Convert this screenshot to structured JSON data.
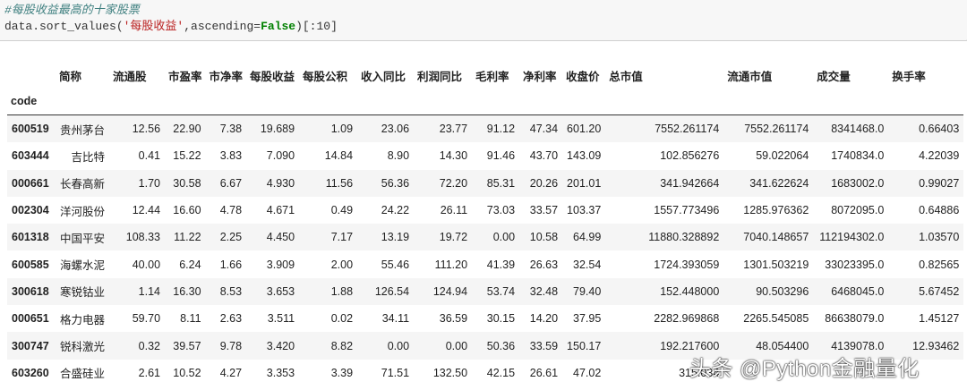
{
  "code_cell": {
    "comment": "#每股收益最高的十家股票",
    "code_prefix": "data.sort_values(",
    "code_string": "'每股收益'",
    "code_mid": ",ascending=",
    "code_keyword": "False",
    "code_suffix": ")[:10]"
  },
  "table": {
    "index_name": "code",
    "columns": [
      "简称",
      "流通股",
      "市盈率",
      "市净率",
      "每股收益",
      "每股公积",
      "收入同比",
      "利润同比",
      "毛利率",
      "净利率",
      "收盘价",
      "总市值",
      "流通市值",
      "成交量",
      "换手率"
    ],
    "rows": [
      [
        "600519",
        "贵州茅台",
        "12.56",
        "22.90",
        "7.38",
        "19.689",
        "1.09",
        "23.06",
        "23.77",
        "91.12",
        "47.34",
        "601.20",
        "7552.261174",
        "7552.261174",
        "8341468.0",
        "0.66403"
      ],
      [
        "603444",
        "吉比特",
        "0.41",
        "15.22",
        "3.83",
        "7.090",
        "14.84",
        "8.90",
        "14.30",
        "91.46",
        "43.70",
        "143.09",
        "102.856276",
        "59.022064",
        "1740834.0",
        "4.22039"
      ],
      [
        "000661",
        "长春高新",
        "1.70",
        "30.58",
        "6.67",
        "4.930",
        "11.56",
        "56.36",
        "72.20",
        "85.31",
        "20.26",
        "201.01",
        "341.942664",
        "341.622624",
        "1683002.0",
        "0.99027"
      ],
      [
        "002304",
        "洋河股份",
        "12.44",
        "16.60",
        "4.78",
        "4.671",
        "0.49",
        "24.22",
        "26.11",
        "73.03",
        "33.57",
        "103.37",
        "1557.773496",
        "1285.976362",
        "8072095.0",
        "0.64886"
      ],
      [
        "601318",
        "中国平安",
        "108.33",
        "11.22",
        "2.25",
        "4.450",
        "7.17",
        "13.19",
        "19.72",
        "0.00",
        "10.58",
        "64.99",
        "11880.328892",
        "7040.148657",
        "112194302.0",
        "1.03570"
      ],
      [
        "600585",
        "海螺水泥",
        "40.00",
        "6.24",
        "1.66",
        "3.909",
        "2.00",
        "55.46",
        "111.20",
        "41.39",
        "26.63",
        "32.54",
        "1724.393059",
        "1301.503219",
        "33023395.0",
        "0.82565"
      ],
      [
        "300618",
        "寒锐钴业",
        "1.14",
        "16.30",
        "8.53",
        "3.653",
        "1.88",
        "126.54",
        "124.94",
        "53.74",
        "32.48",
        "79.40",
        "152.448000",
        "90.503296",
        "6468045.0",
        "5.67452"
      ],
      [
        "000651",
        "格力电器",
        "59.70",
        "8.11",
        "2.63",
        "3.511",
        "0.02",
        "34.11",
        "36.59",
        "30.15",
        "14.20",
        "37.95",
        "2282.969868",
        "2265.545085",
        "86638079.0",
        "1.45127"
      ],
      [
        "300747",
        "锐科激光",
        "0.32",
        "39.57",
        "9.78",
        "3.420",
        "8.82",
        "0.00",
        "0.00",
        "50.36",
        "33.59",
        "150.17",
        "192.217600",
        "48.054400",
        "4139078.0",
        "12.93462"
      ],
      [
        "603260",
        "合盛硅业",
        "2.61",
        "10.52",
        "4.27",
        "3.353",
        "3.39",
        "71.51",
        "132.50",
        "42.15",
        "26.61",
        "47.02",
        "315.034",
        "",
        "",
        ""
      ]
    ]
  },
  "watermark": "头条 @Python金融量化"
}
